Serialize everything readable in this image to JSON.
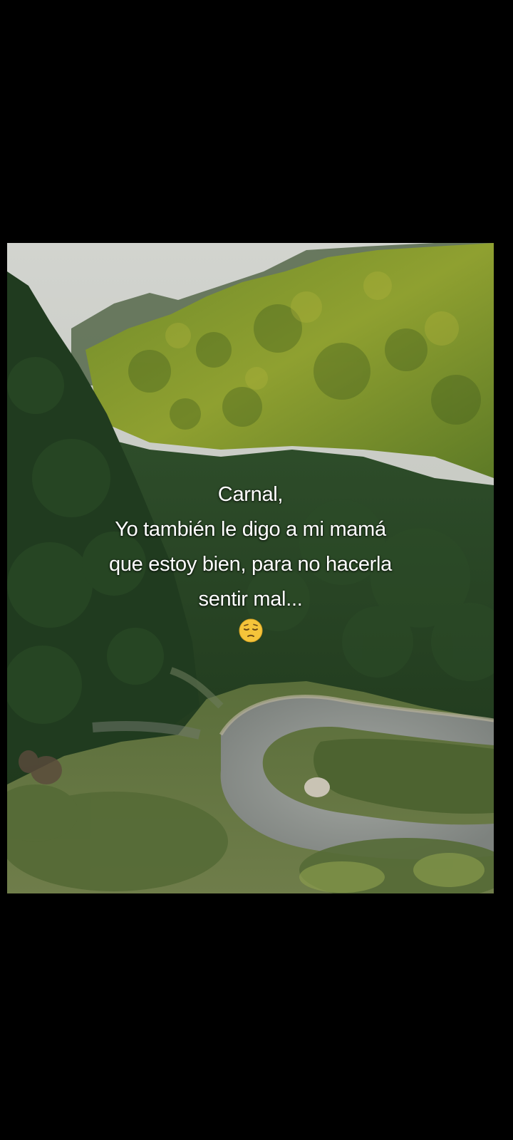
{
  "caption": {
    "lines": [
      "Carnal,",
      "Yo también le digo a mi mamá",
      "que estoy bien, para no hacerla",
      "sentir mal..."
    ],
    "emoji": "pensive-face-emoji"
  },
  "colors": {
    "background": "#000000",
    "caption_text": "#ffffff",
    "sky": "#c9ccc6",
    "forest_dark": "#1f3a1e",
    "forest_lit": "#8a9a2e",
    "road": "#8f9490",
    "emoji_face": "#f5c43a"
  }
}
